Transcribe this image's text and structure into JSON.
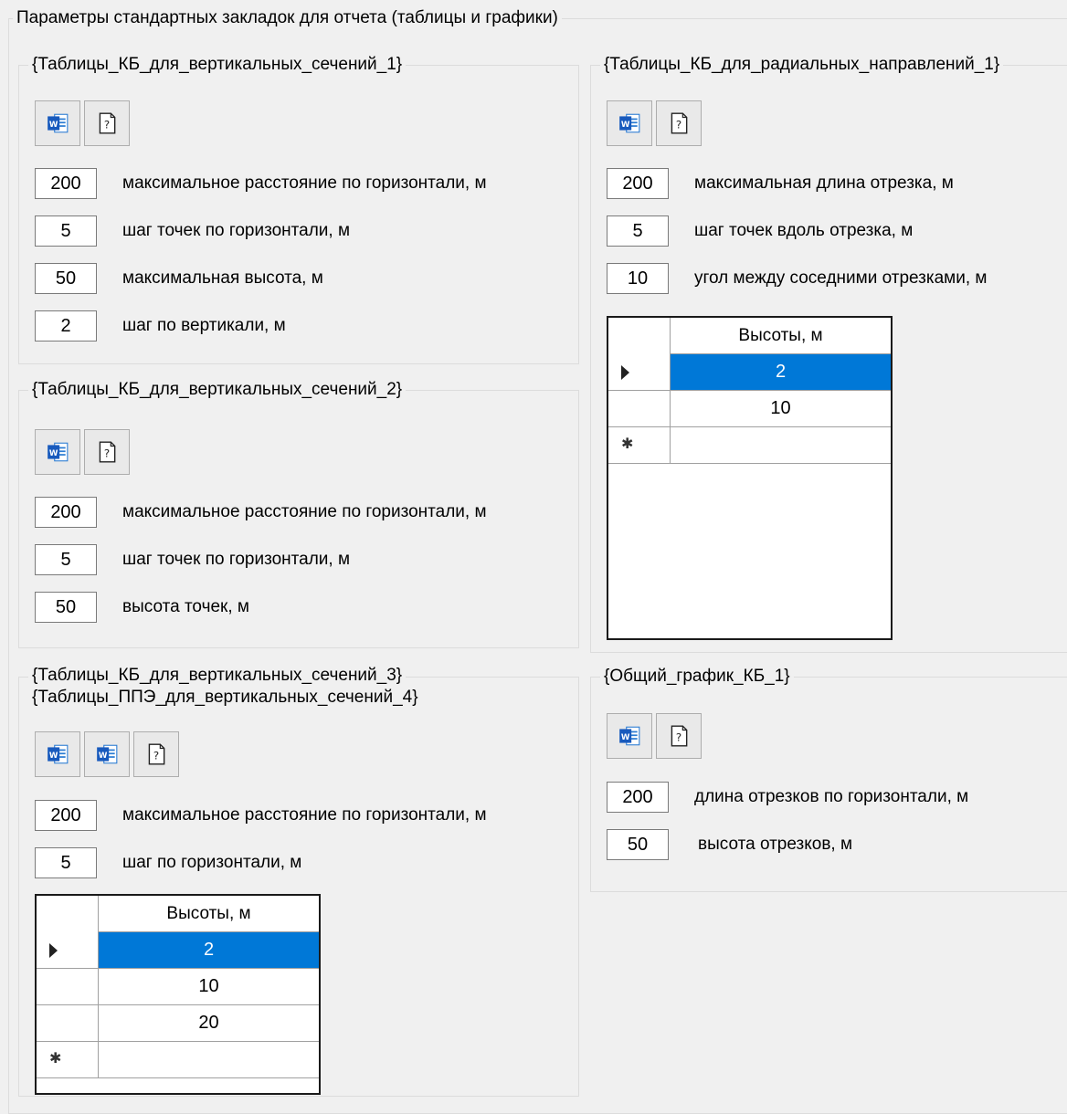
{
  "main_title": "Параметры стандартных закладок для отчета (таблицы и графики)",
  "groups": {
    "vs1": {
      "title": "{Таблицы_КБ_для_вертикальных_сечений_1}",
      "rows": [
        {
          "value": "200",
          "label": "максимальное расстояние по горизонтали, м"
        },
        {
          "value": "5",
          "label": "шаг точек по горизонтали, м"
        },
        {
          "value": "50",
          "label": "максимальная высота, м"
        },
        {
          "value": "2",
          "label": "шаг по вертикали, м"
        }
      ]
    },
    "vs2": {
      "title": "{Таблицы_КБ_для_вертикальных_сечений_2}",
      "rows": [
        {
          "value": "200",
          "label": "максимальное расстояние по горизонтали, м"
        },
        {
          "value": "5",
          "label": "шаг точек по горизонтали, м"
        },
        {
          "value": "50",
          "label": "высота точек, м"
        }
      ]
    },
    "vs3": {
      "title_line1": "{Таблицы_КБ_для_вертикальных_сечений_3}",
      "title_line2": "{Таблицы_ППЭ_для_вертикальных_сечений_4}",
      "rows": [
        {
          "value": "200",
          "label": "максимальное расстояние по горизонтали, м"
        },
        {
          "value": "5",
          "label": "шаг по горизонтали, м"
        }
      ],
      "grid": {
        "header": "Высоты, м",
        "values": [
          "2",
          "10",
          "20"
        ],
        "selected_index": 0
      }
    },
    "rad1": {
      "title": "{Таблицы_КБ_для_радиальных_направлений_1}",
      "rows": [
        {
          "value": "200",
          "label": "максимальная длина отрезка, м"
        },
        {
          "value": "5",
          "label": "шаг точек вдоль отрезка, м"
        },
        {
          "value": "10",
          "label": "угол между соседними отрезками, м"
        }
      ],
      "grid": {
        "header": "Высоты, м",
        "values": [
          "2",
          "10"
        ],
        "selected_index": 0
      }
    },
    "graph1": {
      "title": "{Общий_график_КБ_1}",
      "rows": [
        {
          "value": "200",
          "label": "длина отрезков по горизонтали, м"
        },
        {
          "value": "50",
          "label": "высота отрезков, м"
        }
      ]
    }
  },
  "icons": {
    "word": "word-document-icon",
    "help": "help-question-icon"
  },
  "colors": {
    "selection": "#0078d7",
    "word_blue": "#185abd"
  }
}
